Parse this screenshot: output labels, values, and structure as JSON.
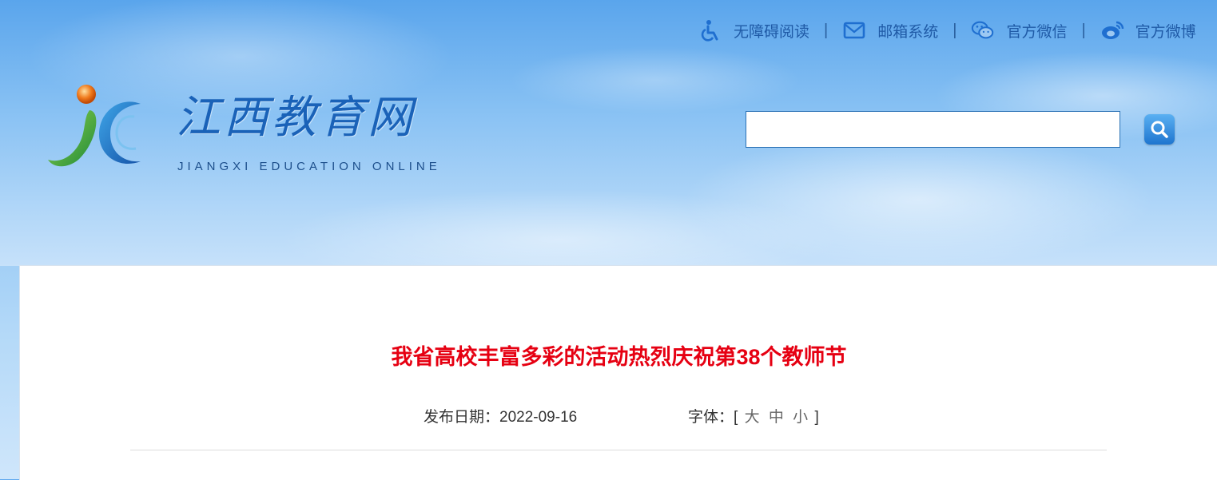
{
  "top_links": [
    {
      "label": "无障碍阅读",
      "icon": "accessibility-icon"
    },
    {
      "label": "邮箱系统",
      "icon": "mail-icon"
    },
    {
      "label": "官方微信",
      "icon": "wechat-icon"
    },
    {
      "label": "官方微博",
      "icon": "weibo-icon"
    }
  ],
  "separator": "|",
  "logo": {
    "title": "江西教育网",
    "subtitle": "JIANGXI EDUCATION ONLINE"
  },
  "search": {
    "value": "",
    "placeholder": "",
    "icon": "search-icon"
  },
  "article": {
    "title": "我省高校丰富多彩的活动热烈庆祝第38个教师节",
    "date_label": "发布日期：",
    "date": "2022-09-16",
    "font_label": "字体：",
    "bracket_open": "[",
    "bracket_close": "]",
    "font_sizes": [
      "大",
      "中",
      "小"
    ]
  },
  "colors": {
    "title_red": "#e60012",
    "link_blue": "#1f5aa6",
    "logo_blue": "#1a62b8"
  }
}
